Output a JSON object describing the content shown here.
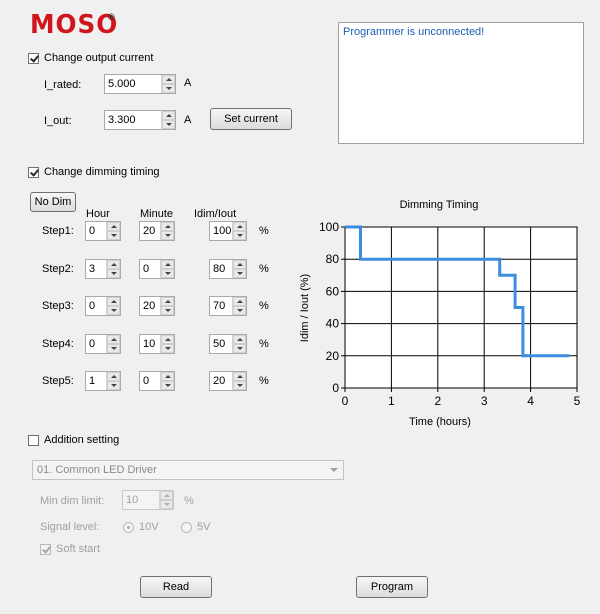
{
  "brand": {
    "logo_text": "MOSO",
    "reg_mark": "®"
  },
  "output_current": {
    "checkbox_label": "Change output current",
    "checked": true,
    "i_rated_label": "I_rated:",
    "i_rated_value": "5.000",
    "i_rated_unit": "A",
    "i_out_label": "I_out:",
    "i_out_value": "3.300",
    "i_out_unit": "A",
    "set_current_label": "Set current"
  },
  "status_box": {
    "message": "Programmer is unconnected!"
  },
  "dimming": {
    "checkbox_label": "Change dimming timing",
    "checked": true,
    "no_dim_label": "No Dim",
    "col_hour": "Hour",
    "col_minute": "Minute",
    "col_ratio": "Idim/Iout",
    "percent_sign": "%",
    "steps": [
      {
        "label": "Step1:",
        "hour": "0",
        "minute": "20",
        "ratio": "100"
      },
      {
        "label": "Step2:",
        "hour": "3",
        "minute": "0",
        "ratio": "80"
      },
      {
        "label": "Step3:",
        "hour": "0",
        "minute": "20",
        "ratio": "70"
      },
      {
        "label": "Step4:",
        "hour": "0",
        "minute": "10",
        "ratio": "50"
      },
      {
        "label": "Step5:",
        "hour": "1",
        "minute": "0",
        "ratio": "20"
      }
    ]
  },
  "chart_data": {
    "type": "line",
    "title": "Dimming Timing",
    "xlabel": "Time (hours)",
    "ylabel": "Idim / Iout (%)",
    "xlim": [
      0,
      5
    ],
    "ylim": [
      0,
      100
    ],
    "xticks": [
      "0",
      "1",
      "2",
      "3",
      "4",
      "5"
    ],
    "yticks": [
      "0",
      "20",
      "40",
      "60",
      "80",
      "100"
    ],
    "grid": true,
    "line_color": "#3c8dde",
    "points": [
      [
        0,
        100
      ],
      [
        0.333,
        100
      ],
      [
        0.333,
        80
      ],
      [
        3.333,
        80
      ],
      [
        3.333,
        70
      ],
      [
        3.667,
        70
      ],
      [
        3.667,
        50
      ],
      [
        3.833,
        50
      ],
      [
        3.833,
        20
      ],
      [
        4.833,
        20
      ]
    ]
  },
  "addition": {
    "checkbox_label": "Addition setting",
    "checked": false,
    "driver_select_value": "01. Common LED Driver",
    "min_dim_label": "Min dim limit:",
    "min_dim_value": "10",
    "min_dim_unit": "%",
    "signal_label": "Signal level:",
    "signal_options": [
      "10V",
      "5V"
    ],
    "signal_selected": "10V",
    "soft_start_label": "Soft start",
    "soft_start_checked": true
  },
  "actions": {
    "read_label": "Read",
    "program_label": "Program"
  }
}
